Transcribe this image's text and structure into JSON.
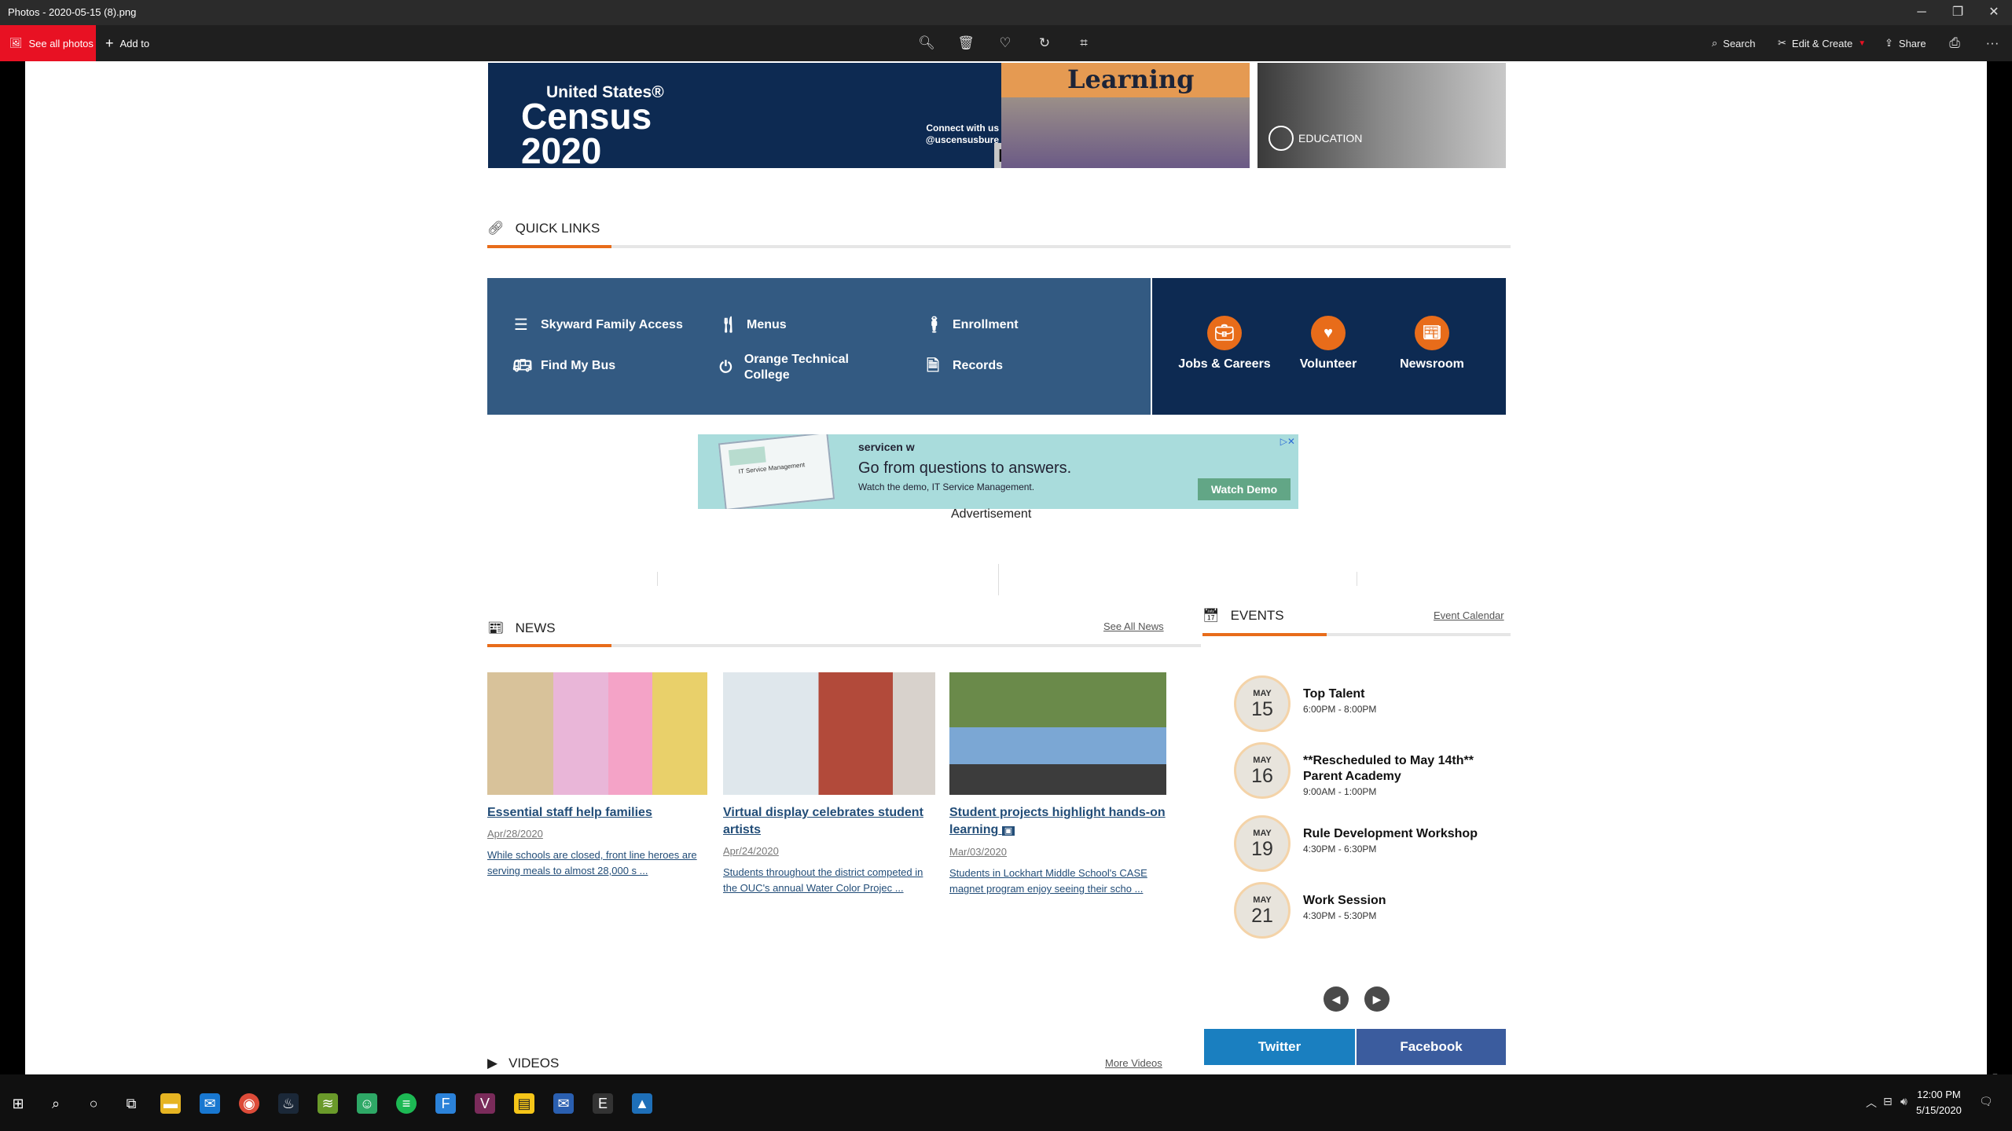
{
  "window": {
    "title": "Photos - 2020-05-15 (8).png",
    "min": "─",
    "max": "❐",
    "close": "✕"
  },
  "toolbar": {
    "see_all": "See all photos",
    "add_to": "Add to",
    "search": "Search",
    "edit_create": "Edit & Create",
    "share": "Share",
    "more": "···"
  },
  "banners": {
    "census_us": "United States®",
    "census_big": "Census\n2020",
    "census_connect": "Connect with us\n@uscensusbure",
    "learning": "Learning",
    "education": "EDUCATION"
  },
  "quick_links": {
    "title": "QUICK LINKS",
    "items": [
      {
        "label": "Skyward Family Access"
      },
      {
        "label": "Menus"
      },
      {
        "label": "Enrollment"
      },
      {
        "label": "Find My Bus"
      },
      {
        "label": "Orange Technical College"
      },
      {
        "label": "Records"
      }
    ],
    "featured": [
      {
        "label": "Jobs & Careers"
      },
      {
        "label": "Volunteer"
      },
      {
        "label": "Newsroom"
      }
    ]
  },
  "ad": {
    "brand": "servicen w",
    "headline": "Go from questions to answers.",
    "sub": "Watch the demo, IT Service Management.",
    "button": "Watch Demo",
    "thumb_text": "IT Service Management",
    "close": "▷✕",
    "label": "Advertisement"
  },
  "news": {
    "title": "NEWS",
    "see_all": "See All News",
    "items": [
      {
        "title": "Essential staff help families",
        "date": "Apr/28/2020",
        "summary": "While schools are closed, front line heroes are serving meals to almost 28,000 s ..."
      },
      {
        "title": "Virtual display celebrates student artists",
        "date": "Apr/24/2020",
        "summary": "Students throughout the district competed in the OUC's annual Water Color Projec ..."
      },
      {
        "title": "Student projects highlight hands-on learning",
        "date": "Mar/03/2020",
        "summary": "Students in Lockhart Middle School's CASE magnet program enjoy seeing their scho ..."
      }
    ]
  },
  "events": {
    "title": "EVENTS",
    "calendar": "Event Calendar",
    "items": [
      {
        "month": "MAY",
        "day": "15",
        "title": "Top Talent",
        "time": "6:00PM - 8:00PM"
      },
      {
        "month": "MAY",
        "day": "16",
        "title": "**Rescheduled to May 14th** Parent Academy",
        "time": "9:00AM - 1:00PM"
      },
      {
        "month": "MAY",
        "day": "19",
        "title": "Rule Development Workshop",
        "time": "4:30PM - 6:30PM"
      },
      {
        "month": "MAY",
        "day": "21",
        "title": "Work Session",
        "time": "4:30PM - 5:30PM"
      }
    ]
  },
  "social": {
    "twitter": "Twitter",
    "facebook": "Facebook"
  },
  "videos": {
    "title": "VIDEOS",
    "more": "More Videos"
  },
  "clock": {
    "time": "12:00 PM",
    "date": "5/15/2020"
  },
  "colors": {
    "accent": "#e86c1a",
    "quicklinks_bg": "#335a82",
    "navy": "#0d2a52",
    "twitter": "#1a7fc0",
    "facebook": "#3b5c9e"
  }
}
